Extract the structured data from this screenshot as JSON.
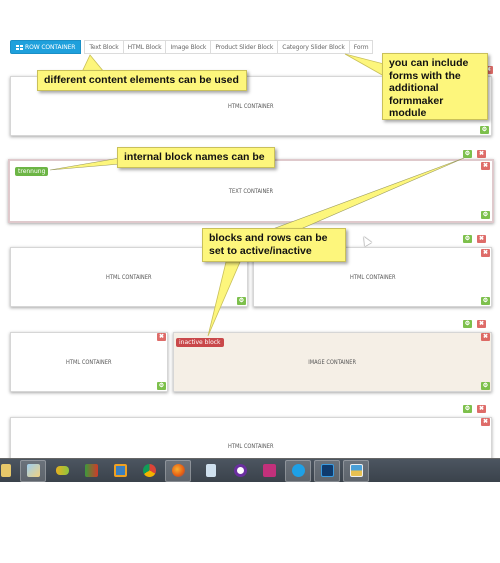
{
  "toolbar": {
    "items": [
      {
        "label": "ROW CONTAINER",
        "icon": "grid-icon",
        "primary": true
      },
      {
        "label": "Text Block"
      },
      {
        "label": "HTML Block"
      },
      {
        "label": "Image Block"
      },
      {
        "label": "Product Slider Block"
      },
      {
        "label": "Category Slider Block"
      },
      {
        "label": "Form"
      }
    ]
  },
  "rows": [
    {
      "blocks": [
        {
          "label": "HTML CONTAINER"
        }
      ]
    },
    {
      "blocks": [
        {
          "label": "TEXT CONTAINER",
          "name_tag": "trennung"
        }
      ]
    },
    {
      "blocks": [
        {
          "label": "HTML CONTAINER"
        },
        {
          "label": "HTML CONTAINER"
        }
      ]
    },
    {
      "blocks": [
        {
          "label": "HTML CONTAINER"
        },
        {
          "label": "IMAGE CONTAINER",
          "status_tag": "inactive block"
        }
      ]
    },
    {
      "blocks": [
        {
          "label": "HTML CONTAINER"
        }
      ]
    }
  ],
  "controls": {
    "settings_icon": "settings-icon",
    "delete_symbol": "✖",
    "settings_symbol": "⚙"
  },
  "callouts": {
    "content_elements": "different content elements can be used",
    "forms": "you can include forms with the additional formmaker module",
    "block_names": "internal block names can be",
    "active_inactive": "blocks and rows can be set to active/inactive"
  },
  "taskbar": {
    "apps": [
      "explorer",
      "paint",
      "messenger",
      "acrobat",
      "media-player",
      "chrome",
      "firefox",
      "calculator",
      "app-purple",
      "indesign",
      "skype",
      "photoshop",
      "photo-viewer"
    ],
    "active_app": "firefox"
  },
  "colors": {
    "primary": "#1ea0dc",
    "green": "#7dc04c",
    "red": "#d9534f",
    "callout": "#fdf67c",
    "inactive_bg": "#f5efe6"
  }
}
